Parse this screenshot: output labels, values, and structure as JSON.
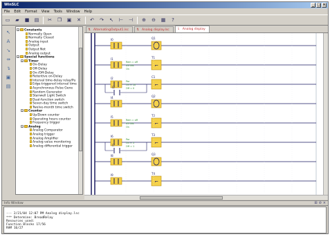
{
  "window": {
    "title": "WinSLC",
    "controls": [
      "_",
      "□",
      "×"
    ]
  },
  "menu": [
    "File",
    "Edit",
    "Format",
    "View",
    "Tools",
    "Window",
    "Help"
  ],
  "toolbar_icons": [
    "new-icon",
    "open-icon",
    "save-icon",
    "print-icon",
    "cut-icon",
    "copy-icon",
    "paste-icon",
    "delete-icon",
    "undo-icon",
    "redo-icon",
    "cursor-icon",
    "connect-icon",
    "simulate-icon",
    "zoom-in-icon",
    "zoom-out-icon",
    "grid-icon",
    "help-icon"
  ],
  "left_tools": [
    "pointer-icon",
    "text-icon",
    "connect-icon",
    "split-icon",
    "insert-icon",
    "comment-icon",
    "block-icon"
  ],
  "tree": [
    {
      "label": "Constants",
      "level": 0,
      "head": true
    },
    {
      "label": "Normally Open",
      "level": 1
    },
    {
      "label": "Normally Closed",
      "level": 1
    },
    {
      "label": "Analog input",
      "level": 1
    },
    {
      "label": "Output",
      "level": 1
    },
    {
      "label": "Output Not",
      "level": 1
    },
    {
      "label": "Analog output",
      "level": 1
    },
    {
      "label": "Special functions",
      "level": 0,
      "head": true
    },
    {
      "label": "Timer",
      "level": 1,
      "head": true
    },
    {
      "label": "On-Delay",
      "level": 2
    },
    {
      "label": "Off-Delay",
      "level": 2
    },
    {
      "label": "On-/Off-Delay",
      "level": 2
    },
    {
      "label": "Retentive on-Delay",
      "level": 2
    },
    {
      "label": "Interval time-delay relay/Pu",
      "level": 2
    },
    {
      "label": "Edge-triggered interval time",
      "level": 2
    },
    {
      "label": "Asynchronous Pulse Gene",
      "level": 2
    },
    {
      "label": "Random Generator",
      "level": 2
    },
    {
      "label": "Stairwell Light Switch",
      "level": 2
    },
    {
      "label": "Dual-function switch",
      "level": 2
    },
    {
      "label": "Seven-day time switch",
      "level": 2
    },
    {
      "label": "Twelve-month time switch",
      "level": 2
    },
    {
      "label": "Counter",
      "level": 1,
      "head": true
    },
    {
      "label": "Up/Down counter",
      "level": 2
    },
    {
      "label": "Operating hours counter",
      "level": 2
    },
    {
      "label": "Frequency trigger",
      "level": 2
    },
    {
      "label": "Analog",
      "level": 1,
      "head": true
    },
    {
      "label": "Analog Comparator",
      "level": 2
    },
    {
      "label": "Analog trigger",
      "level": 2
    },
    {
      "label": "Analog Amplifier",
      "level": 2
    },
    {
      "label": "Analog value monitoring",
      "level": 2
    },
    {
      "label": "Analog differential trigger",
      "level": 2
    }
  ],
  "tabs": [
    {
      "label": "AlternatingOutput1.lsc",
      "active": false
    },
    {
      "label": "Analog display.lsc",
      "active": false
    },
    {
      "label": "Analog display",
      "active": true
    }
  ],
  "diagram": {
    "rungs": [
      {
        "contacts": [
          {
            "label": "I0"
          }
        ],
        "coil": {
          "label": "Q1",
          "type": "coil"
        }
      },
      {
        "contacts": [
          {
            "label": "I1"
          }
        ],
        "coil": {
          "label": "T1",
          "type": "box",
          "params": [
            "Rem = off",
            "03:00s",
            "On"
          ]
        }
      },
      {
        "contacts": [
          {
            "label": "I2"
          },
          {
            "label": "I3"
          }
        ],
        "coil": {
          "label": "C1",
          "type": "box",
          "params": [
            "Par",
            "On = 10",
            "Off = 0"
          ]
        }
      },
      {
        "contacts": [
          {
            "label": "I4"
          }
        ],
        "coil": {
          "label": "Q2",
          "type": "coil"
        }
      },
      {
        "contacts": [
          {
            "label": "I5"
          }
        ],
        "coil": {
          "label": "T2",
          "type": "box",
          "params": [
            "Rem = off",
            "05:00s",
            "On"
          ]
        }
      },
      {
        "contacts": [
          {
            "label": "I6"
          },
          {
            "label": "I7"
          }
        ],
        "coil": {
          "label": "T3",
          "type": "box",
          "params": [
            "Par",
            "On = 5",
            "Off = 1"
          ]
        }
      },
      {
        "contacts": [
          {
            "label": "I8"
          }
        ],
        "coil": {
          "label": "Q3",
          "type": "coil"
        }
      },
      {
        "contacts": [
          {
            "label": "I9"
          }
        ],
        "coil": {
          "label": "T4",
          "type": "box",
          "params": []
        }
      }
    ]
  },
  "output": {
    "title": "Info Window",
    "lines": [
      "",
      "--- 2/21/04 12:07 PM Analog display.lsc",
      "*** Determine: BreadRelay",
      "Resources used:",
      "Function Blocks     17/56",
      "RAM          16/27"
    ]
  },
  "colors": {
    "rung": "#1a1a60",
    "element_fill": "#f5d14a",
    "element_border": "#b88a10",
    "param_text": "#2a8a2a",
    "tab_text": "#c03030"
  }
}
